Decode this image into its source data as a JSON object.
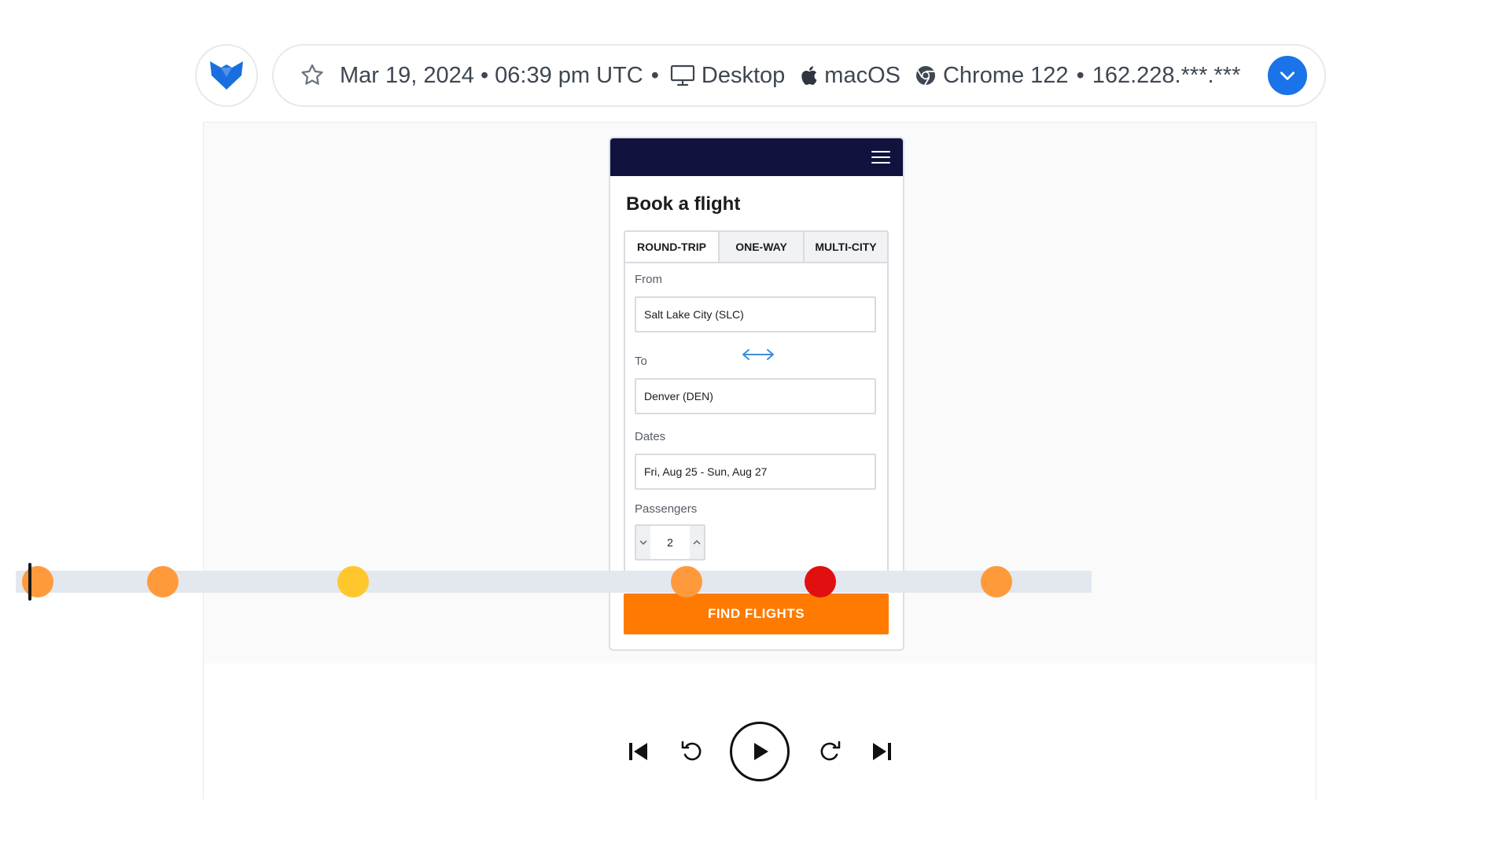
{
  "session": {
    "datetime": "Mar 19, 2024 • 06:39 pm UTC",
    "sep": "•",
    "device": "Desktop",
    "os": "macOS",
    "browser": "Chrome 122",
    "ip": "162.228.***.***",
    "icons": [
      "logo-icon",
      "star-icon",
      "monitor-icon",
      "apple-icon",
      "chrome-icon",
      "chevron-down-icon"
    ]
  },
  "app": {
    "title": "Book a flight",
    "tabs": [
      {
        "label": "ROUND-TRIP",
        "active": true
      },
      {
        "label": "ONE-WAY",
        "active": false
      },
      {
        "label": "MULTI-CITY",
        "active": false
      }
    ],
    "from": {
      "label": "From",
      "value": "Salt Lake City (SLC)"
    },
    "to": {
      "label": "To",
      "value": "Denver (DEN)"
    },
    "dates": {
      "label": "Dates",
      "value": "Fri, Aug 25 - Sun, Aug 27"
    },
    "passengers": {
      "label": "Passengers",
      "value": "2"
    },
    "find_button": "FIND FLIGHTS",
    "colors": {
      "header": "#12123f",
      "primary": "#ff7a00",
      "swap": "#3d8ee0"
    }
  },
  "timeline": {
    "events": [
      {
        "position": 0.006,
        "color": "#ff9a3c"
      },
      {
        "position": 0.122,
        "color": "#ff9a3c"
      },
      {
        "position": 0.299,
        "color": "#ffc72c"
      },
      {
        "position": 0.609,
        "color": "#ff9a3c"
      },
      {
        "position": 0.733,
        "color": "#e01010"
      },
      {
        "position": 0.897,
        "color": "#ff9a3c"
      }
    ],
    "playhead": 0.012,
    "controls": [
      "skip-back-icon",
      "rewind-icon",
      "play-icon",
      "forward-icon",
      "skip-forward-icon"
    ]
  }
}
